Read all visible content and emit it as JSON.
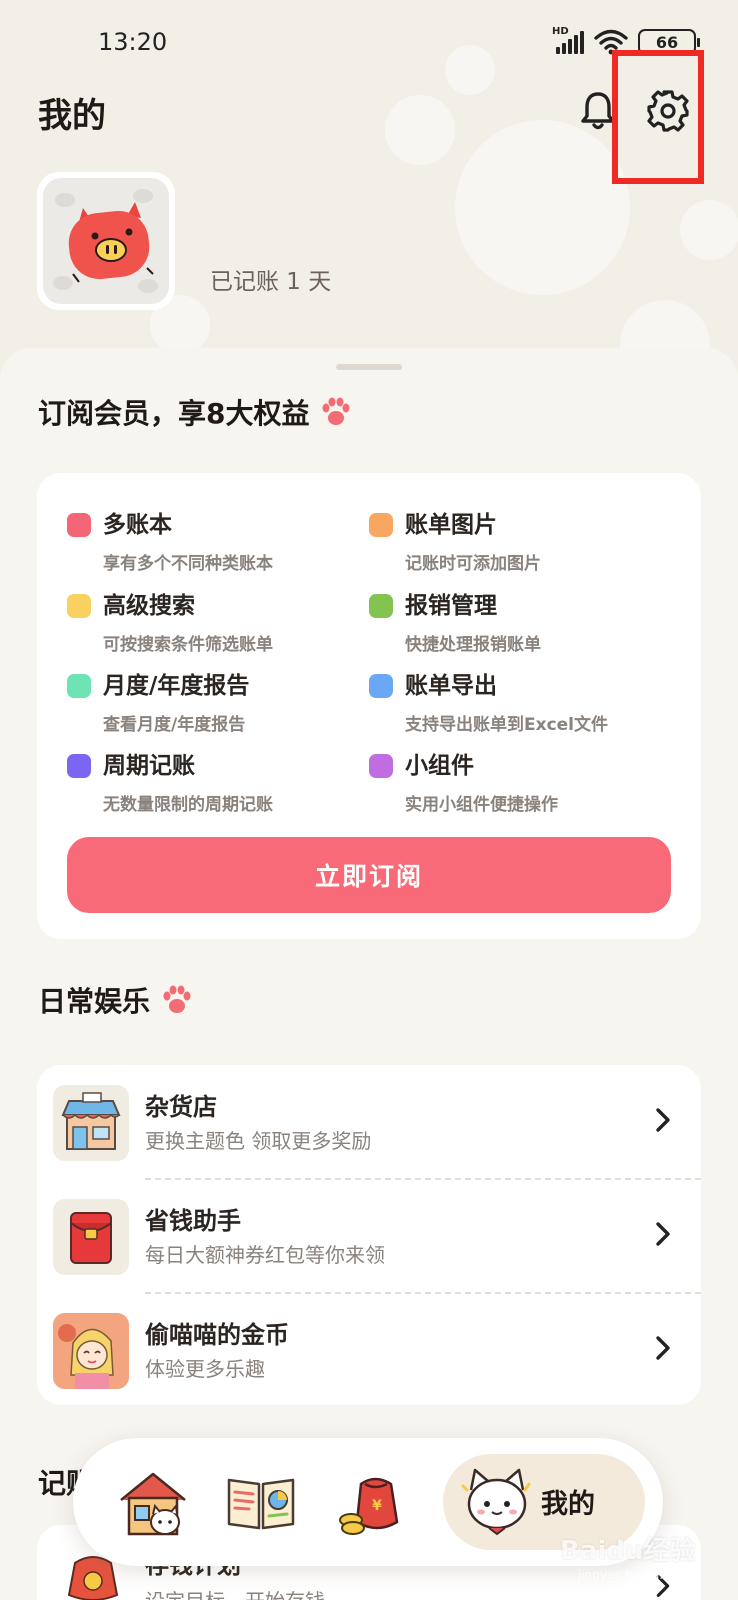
{
  "status_bar": {
    "time": "13:20",
    "network": "HD",
    "battery": "66"
  },
  "header": {
    "title": "我的",
    "bell_icon": "bell-icon",
    "settings_icon": "gear-icon"
  },
  "profile": {
    "avatar_icon": "pig-avatar",
    "days_text": "已记账 1 天"
  },
  "membership": {
    "title": "订阅会员，享8大权益",
    "benefits": [
      {
        "name": "多账本",
        "desc": "享有多个不同种类账本",
        "color": "#f46576"
      },
      {
        "name": "账单图片",
        "desc": "记账时可添加图片",
        "color": "#f9a660"
      },
      {
        "name": "高级搜索",
        "desc": "可按搜索条件筛选账单",
        "color": "#f9d161"
      },
      {
        "name": "报销管理",
        "desc": "快捷处理报销账单",
        "color": "#82c351"
      },
      {
        "name": "月度/年度报告",
        "desc": "查看月度/年度报告",
        "color": "#6ee3b4"
      },
      {
        "name": "账单导出",
        "desc": "支持导出账单到Excel文件",
        "color": "#6aa8f5"
      },
      {
        "name": "周期记账",
        "desc": "无数量限制的周期记账",
        "color": "#7b66f3"
      },
      {
        "name": "小组件",
        "desc": "实用小组件便捷操作",
        "color": "#bf6de0"
      }
    ],
    "subscribe_label": "立即订阅",
    "accent": "#f86a77"
  },
  "entertainment": {
    "title": "日常娱乐",
    "items": [
      {
        "title": "杂货店",
        "desc": "更换主题色 领取更多奖励",
        "icon": "shop-icon"
      },
      {
        "title": "省钱助手",
        "desc": "每日大额神券红包等你来领",
        "icon": "red-envelope-icon"
      },
      {
        "title": "偷喵喵的金币",
        "desc": "体验更多乐趣",
        "icon": "game-character-icon"
      }
    ]
  },
  "records": {
    "title": "记账",
    "peek_item": {
      "title": "存钱计划",
      "desc": "设定目标，开始存钱"
    }
  },
  "bottom_nav": {
    "items": [
      {
        "icon": "home-cat-icon"
      },
      {
        "icon": "book-icon"
      },
      {
        "icon": "money-bag-icon"
      },
      {
        "icon": "cat-face-icon",
        "label": "我的"
      }
    ]
  },
  "watermark": {
    "text": "Baidu经验",
    "sub": "jingyan.baidu.com"
  }
}
